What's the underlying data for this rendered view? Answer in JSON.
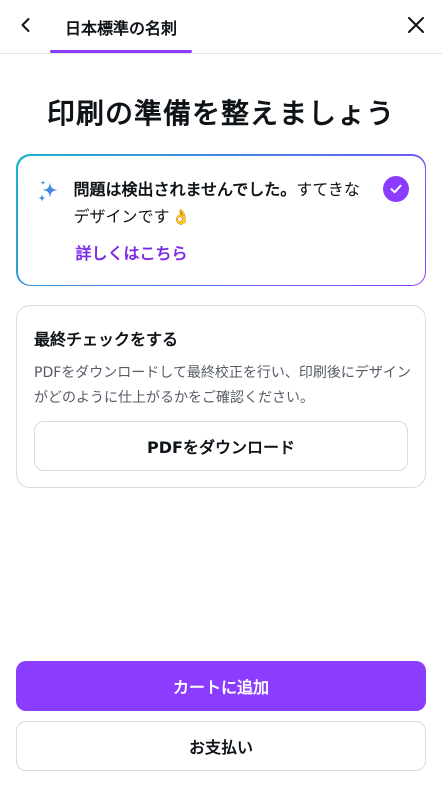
{
  "header": {
    "tab_label": "日本標準の名刺"
  },
  "main": {
    "headline": "印刷の準備を整えましょう",
    "status": {
      "bold_text": "問題は検出されませんでした。",
      "rest_text": "すてきなデザインです",
      "emoji": "👌",
      "link_label": "詳しくはこちら"
    },
    "final_check": {
      "title": "最終チェックをする",
      "description": "PDFをダウンロードして最終校正を行い、印刷後にデザインがどのように仕上がるかをご確認ください。",
      "button_label": "PDFをダウンロード"
    }
  },
  "footer": {
    "cart_label": "カートに追加",
    "pay_label": "お支払い"
  },
  "icons": {
    "back": "chevron-left-icon",
    "close": "close-icon",
    "sparkle": "sparkle-icon",
    "check": "check-circle-icon"
  },
  "colors": {
    "accent": "#8b3dff",
    "link": "#7d2ae8",
    "border": "#d8dbe0",
    "gradient_start": "#1fb3c9",
    "gradient_end": "#8b3dff"
  }
}
